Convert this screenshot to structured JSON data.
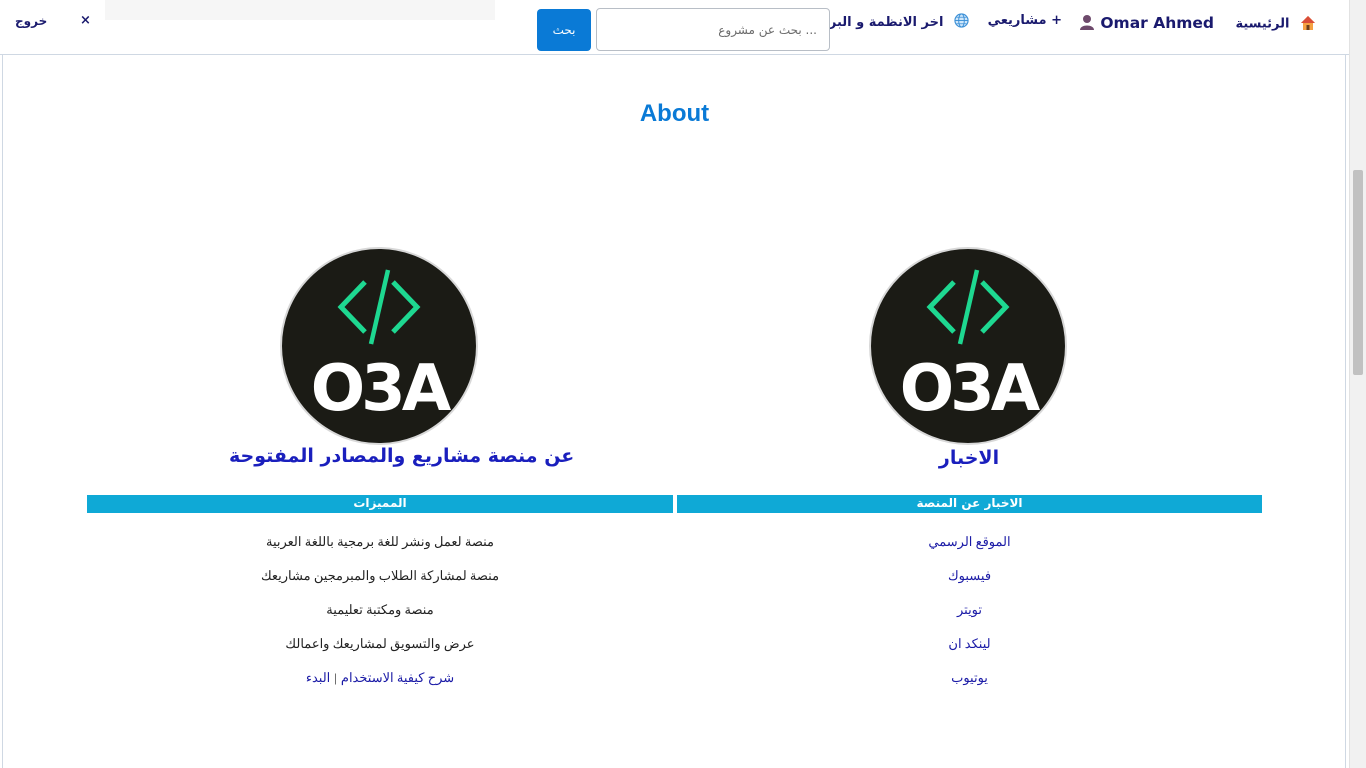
{
  "nav": {
    "home_label": "الرئيسية",
    "user_label": "Omar Ahmed",
    "projects_label": "مشاريعي +",
    "systems_label": "اخر الانظمة و البرامج",
    "logout_label": "خروج",
    "close_glyph": "×"
  },
  "search": {
    "placeholder": "... بحث عن مشروع",
    "value": "",
    "button_label": "بحث"
  },
  "main": {
    "title": "About",
    "right_column": {
      "logo_text": "O3A",
      "heading": "الاخبار",
      "bar_label": "الاخبار عن المنصة",
      "links": [
        "الموقع الرسمي",
        "فيسبوك",
        "تويتر",
        "لينكد ان",
        "يوتيوب"
      ]
    },
    "left_column": {
      "logo_text": "O3A",
      "heading": "عن منصة مشاريع والمصادر المفتوحة",
      "bar_label": "المميزات",
      "features": [
        "منصة لعمل ونشر للغة برمجية باللغة العربية",
        "منصة لمشاركة الطلاب والمبرمجين مشاريعك",
        "منصة ومكتبة تعليمية",
        "عرض والتسويق لمشاريعك واعمالك"
      ],
      "guide_link": "شرح كيفية الاستخدام",
      "separator": "|",
      "start_link": "البدء"
    }
  },
  "colors": {
    "accent_blue": "#0a7ad6",
    "bar_cyan": "#0fa9d6",
    "link_navy": "#1a1aa6",
    "nav_text": "#1a1a6e",
    "logo_bg": "#1b1b15",
    "logo_green": "#1ed891"
  },
  "icons": {
    "home": "house-icon",
    "user": "person-icon",
    "systems": "globe-icon",
    "logout": "close-icon",
    "logo": "code-brackets-icon"
  }
}
